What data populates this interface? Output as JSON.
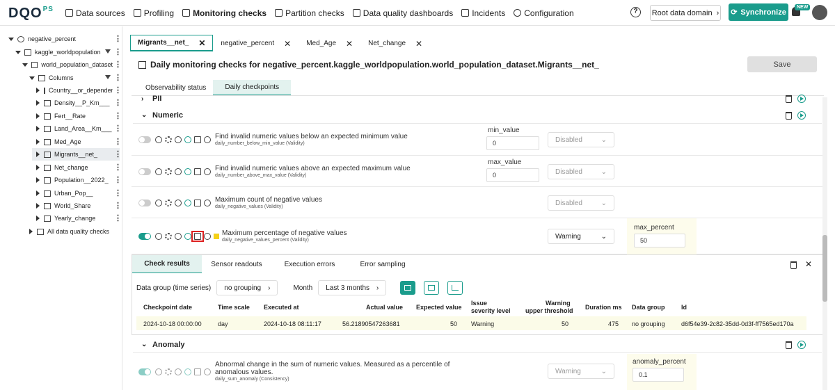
{
  "app": {
    "logo_text": "DQO",
    "logo_suffix": "PS"
  },
  "nav": [
    {
      "label": "Data sources",
      "active": false
    },
    {
      "label": "Profiling",
      "active": false
    },
    {
      "label": "Monitoring checks",
      "active": true
    },
    {
      "label": "Partition checks",
      "active": false
    },
    {
      "label": "Data quality dashboards",
      "active": false
    },
    {
      "label": "Incidents",
      "active": false
    },
    {
      "label": "Configuration",
      "active": false
    }
  ],
  "header": {
    "help": "?",
    "domain_label": "Root data domain",
    "sync_label": "Synchronize",
    "new_badge": "NEW"
  },
  "tree": [
    {
      "label": "negative_percent",
      "expanded": true
    },
    {
      "label": "kaggle_worldpopulation",
      "expanded": true
    },
    {
      "label": "world_population_dataset",
      "expanded": true
    },
    {
      "label": "Columns",
      "expanded": true
    },
    {
      "label": "Country__or_dependency"
    },
    {
      "label": "Density__P_Km___"
    },
    {
      "label": "Fert__Rate"
    },
    {
      "label": "Land_Area__Km___"
    },
    {
      "label": "Med_Age"
    },
    {
      "label": "Migrants__net_",
      "selected": true
    },
    {
      "label": "Net_change"
    },
    {
      "label": "Population__2022_"
    },
    {
      "label": "Urban_Pop__"
    },
    {
      "label": "World_Share"
    },
    {
      "label": "Yearly_change"
    },
    {
      "label": "All data quality checks"
    }
  ],
  "tabs": [
    "Migrants__net_",
    "negative_percent",
    "Med_Age",
    "Net_change"
  ],
  "page": {
    "title": "Daily monitoring checks for negative_percent.kaggle_worldpopulation.world_population_dataset.Migrants__net_",
    "save_label": "Save",
    "subtabs": [
      "Observability status",
      "Daily checkpoints"
    ]
  },
  "sections": {
    "pii": "PII",
    "numeric": "Numeric",
    "anomaly": "Anomaly"
  },
  "checks": [
    {
      "title": "Find invalid numeric values below an expected minimum value",
      "sub": "daily_number_below_min_value (Validity)",
      "param_label": "min_value",
      "param_value": "0",
      "severity": "Disabled"
    },
    {
      "title": "Find invalid numeric values above an expected maximum value",
      "sub": "daily_number_above_max_value (Validity)",
      "param_label": "max_value",
      "param_value": "0",
      "severity": "Disabled"
    },
    {
      "title": "Maximum count of negative values",
      "sub": "daily_negative_values (Validity)",
      "severity": "Disabled"
    },
    {
      "title": "Maximum percentage of negative values",
      "sub": "daily_negative_values_percent (Validity)",
      "param_label": "max_percent",
      "param_value": "50",
      "severity": "Warning"
    },
    {
      "title": "Abnormal change in the sum of numeric values. Measured as a percentile of",
      "title2": "anomalous values.",
      "sub": "daily_sum_anomaly (Consistency)",
      "param_label": "anomaly_percent",
      "param_value": "0.1",
      "severity": "Warning"
    }
  ],
  "results": {
    "tabs": [
      "Check results",
      "Sensor readouts",
      "Execution errors",
      "Error sampling"
    ],
    "data_group_label": "Data group (time series)",
    "data_group_value": "no grouping",
    "month_label": "Month",
    "month_value": "Last 3 months",
    "columns": [
      "Checkpoint date",
      "Time scale",
      "Executed at",
      "Actual value",
      "Expected value",
      "Issue",
      "severity level",
      "Warning",
      "upper threshold",
      "Duration ms",
      "Data group",
      "Id"
    ],
    "row": [
      "2024-10-18 00:00:00",
      "day",
      "2024-10-18 08:11:17",
      "56.21890547263681",
      "50",
      "Warning",
      "50",
      "475",
      "no grouping",
      "d6f54e39-2c82-35dd-0d3f-ff7565ed170a"
    ]
  }
}
